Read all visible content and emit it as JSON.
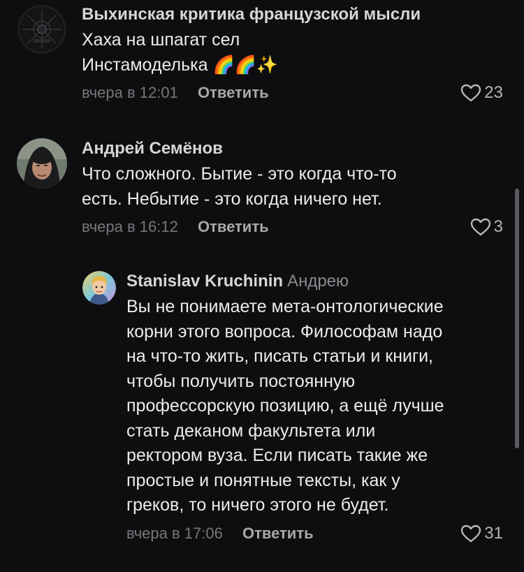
{
  "comments": [
    {
      "author": "Выхинская критика французской мысли",
      "text": "Хаха на шпагат сел\nИнстамоделька 🌈🌈✨",
      "time": "вчера в 12:01",
      "reply_label": "Ответить",
      "likes": "23",
      "avatar": "dark-emblem-avatar"
    },
    {
      "author": "Андрей Семёнов",
      "text": "Что сложного. Бытие - это когда что-то\nесть. Небытие - это когда ничего нет.",
      "time": "вчера в 16:12",
      "reply_label": "Ответить",
      "likes": "3",
      "avatar": "hooded-man-photo-avatar"
    }
  ],
  "reply": {
    "author": "Stanislav Kruchinin",
    "reply_to": "Андрею",
    "text": "Вы не понимаете мета-онтологические\nкорни этого вопроса. Философам надо\nна что-то жить, писать статьи и книги,\nчтобы получить постоянную\nпрофессорскую позицию, а ещё лучше\nстать деканом факультета или\nректором вуза. Если писать такие же\nпростые и понятные тексты, как у\nгреков, то ничего этого не будет.",
    "time": "вчера в 17:06",
    "reply_label": "Ответить",
    "likes": "31",
    "avatar": "cartoon-blond-avatar"
  },
  "colors": {
    "background": "#0e0e10",
    "text": "#ececee",
    "muted": "#77777b"
  }
}
